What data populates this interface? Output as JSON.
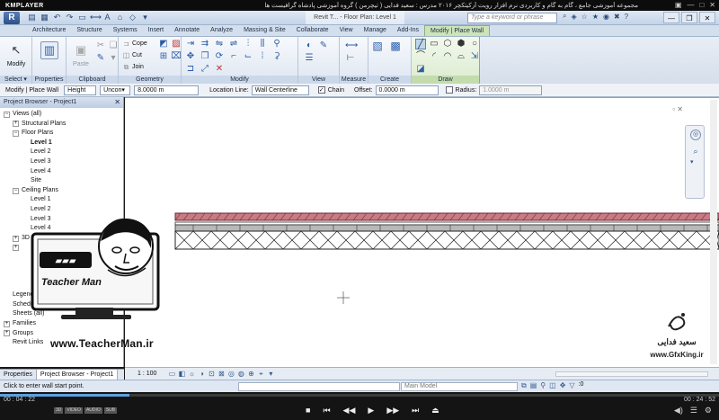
{
  "player": {
    "logo": "KMPLAYER",
    "title": "مجموعه آموزشی جامع ، گام به گام و کاربردی نرم افزار رویت آرکیتکچر ۲۰۱۶ مدرس : سعید فدایی ( تیچرمن ) گروه آموزشی پادشاه گرافیست ها",
    "time_elapsed": "00 : 04 : 22",
    "time_total": "00 : 24 : 52",
    "badges": [
      "3D",
      "VIDEO",
      "AUDIO",
      "SUB"
    ],
    "progress": 0.18
  },
  "app": {
    "button": "R",
    "doc_title": "Revit T... - Floor Plan: Level 1",
    "search_placeholder": "Type a keyword or phrase"
  },
  "ribbon": {
    "tabs": [
      "Architecture",
      "Structure",
      "Systems",
      "Insert",
      "Annotate",
      "Analyze",
      "Massing & Site",
      "Collaborate",
      "View",
      "Manage",
      "Add-Ins",
      "Modify | Place Wall"
    ],
    "active_tab": "Modify | Place Wall",
    "select": {
      "label": "Modify",
      "panel": "Select ▾"
    },
    "properties": {
      "label": "Properties",
      "panel": "Properties"
    },
    "clipboard": {
      "paste": "Paste",
      "panel": "Clipboard"
    },
    "geometry": {
      "cope": "Cope",
      "cut": "Cut",
      "join": "Join",
      "panel": "Geometry"
    },
    "modify_panel": "Modify",
    "view_panel": "View",
    "measure_panel": "Measure",
    "create_panel": "Create",
    "draw_panel": "Draw"
  },
  "options": {
    "context": "Modify | Place Wall",
    "height_mode": "Height",
    "unconnected": "Uncon▾",
    "height_value": "8.0000 m",
    "location_label": "Location Line:",
    "location_value": "Wall Centerline",
    "chain_label": "Chain",
    "chain_checked": "✓",
    "offset_label": "Offset:",
    "offset_value": "0.0000 m",
    "radius_label": "Radius:",
    "radius_value": "1.0000 m"
  },
  "browser": {
    "title": "Project Browser - Project1",
    "tree": [
      {
        "label": "Views (all)",
        "toggle": "−",
        "indent": 0
      },
      {
        "label": "Structural Plans",
        "toggle": "+",
        "indent": 1
      },
      {
        "label": "Floor Plans",
        "toggle": "−",
        "indent": 1
      },
      {
        "label": "Level 1",
        "toggle": "",
        "indent": 2,
        "bold": true
      },
      {
        "label": "Level 2",
        "toggle": "",
        "indent": 2
      },
      {
        "label": "Level 3",
        "toggle": "",
        "indent": 2
      },
      {
        "label": "Level 4",
        "toggle": "",
        "indent": 2
      },
      {
        "label": "Site",
        "toggle": "",
        "indent": 2
      },
      {
        "label": "Ceiling Plans",
        "toggle": "−",
        "indent": 1
      },
      {
        "label": "Level 1",
        "toggle": "",
        "indent": 2
      },
      {
        "label": "Level 2",
        "toggle": "",
        "indent": 2
      },
      {
        "label": "Level 3",
        "toggle": "",
        "indent": 2
      },
      {
        "label": "Level 4",
        "toggle": "",
        "indent": 2
      },
      {
        "label": "3D Views",
        "toggle": "+",
        "indent": 1
      },
      {
        "label": "",
        "toggle": "+",
        "indent": 1
      },
      {
        "label": "",
        "toggle": "",
        "indent": 1
      },
      {
        "label": "",
        "toggle": "",
        "indent": 1
      },
      {
        "label": "",
        "toggle": "",
        "indent": 1
      },
      {
        "label": "",
        "toggle": "",
        "indent": 1
      },
      {
        "label": "Legends",
        "toggle": "",
        "indent": 0
      },
      {
        "label": "Schedules/Quantities",
        "toggle": "",
        "indent": 0
      },
      {
        "label": "Sheets (all)",
        "toggle": "",
        "indent": 0
      },
      {
        "label": "Families",
        "toggle": "+",
        "indent": 0
      },
      {
        "label": "Groups",
        "toggle": "+",
        "indent": 0
      },
      {
        "label": "Revit Links",
        "toggle": "",
        "indent": 0
      }
    ],
    "tabs": [
      "Properties",
      "Project Browser - Project1"
    ]
  },
  "logo": {
    "brand": "Teacher Man",
    "url": "www.TeacherMan.ir"
  },
  "watermark": {
    "name": "سعید فدایی",
    "site": "www.GfxKing.ir"
  },
  "view_ctrl": {
    "scale": "1 : 100"
  },
  "status": {
    "text": "Click to enter wall start point.",
    "model": "Main Model"
  }
}
